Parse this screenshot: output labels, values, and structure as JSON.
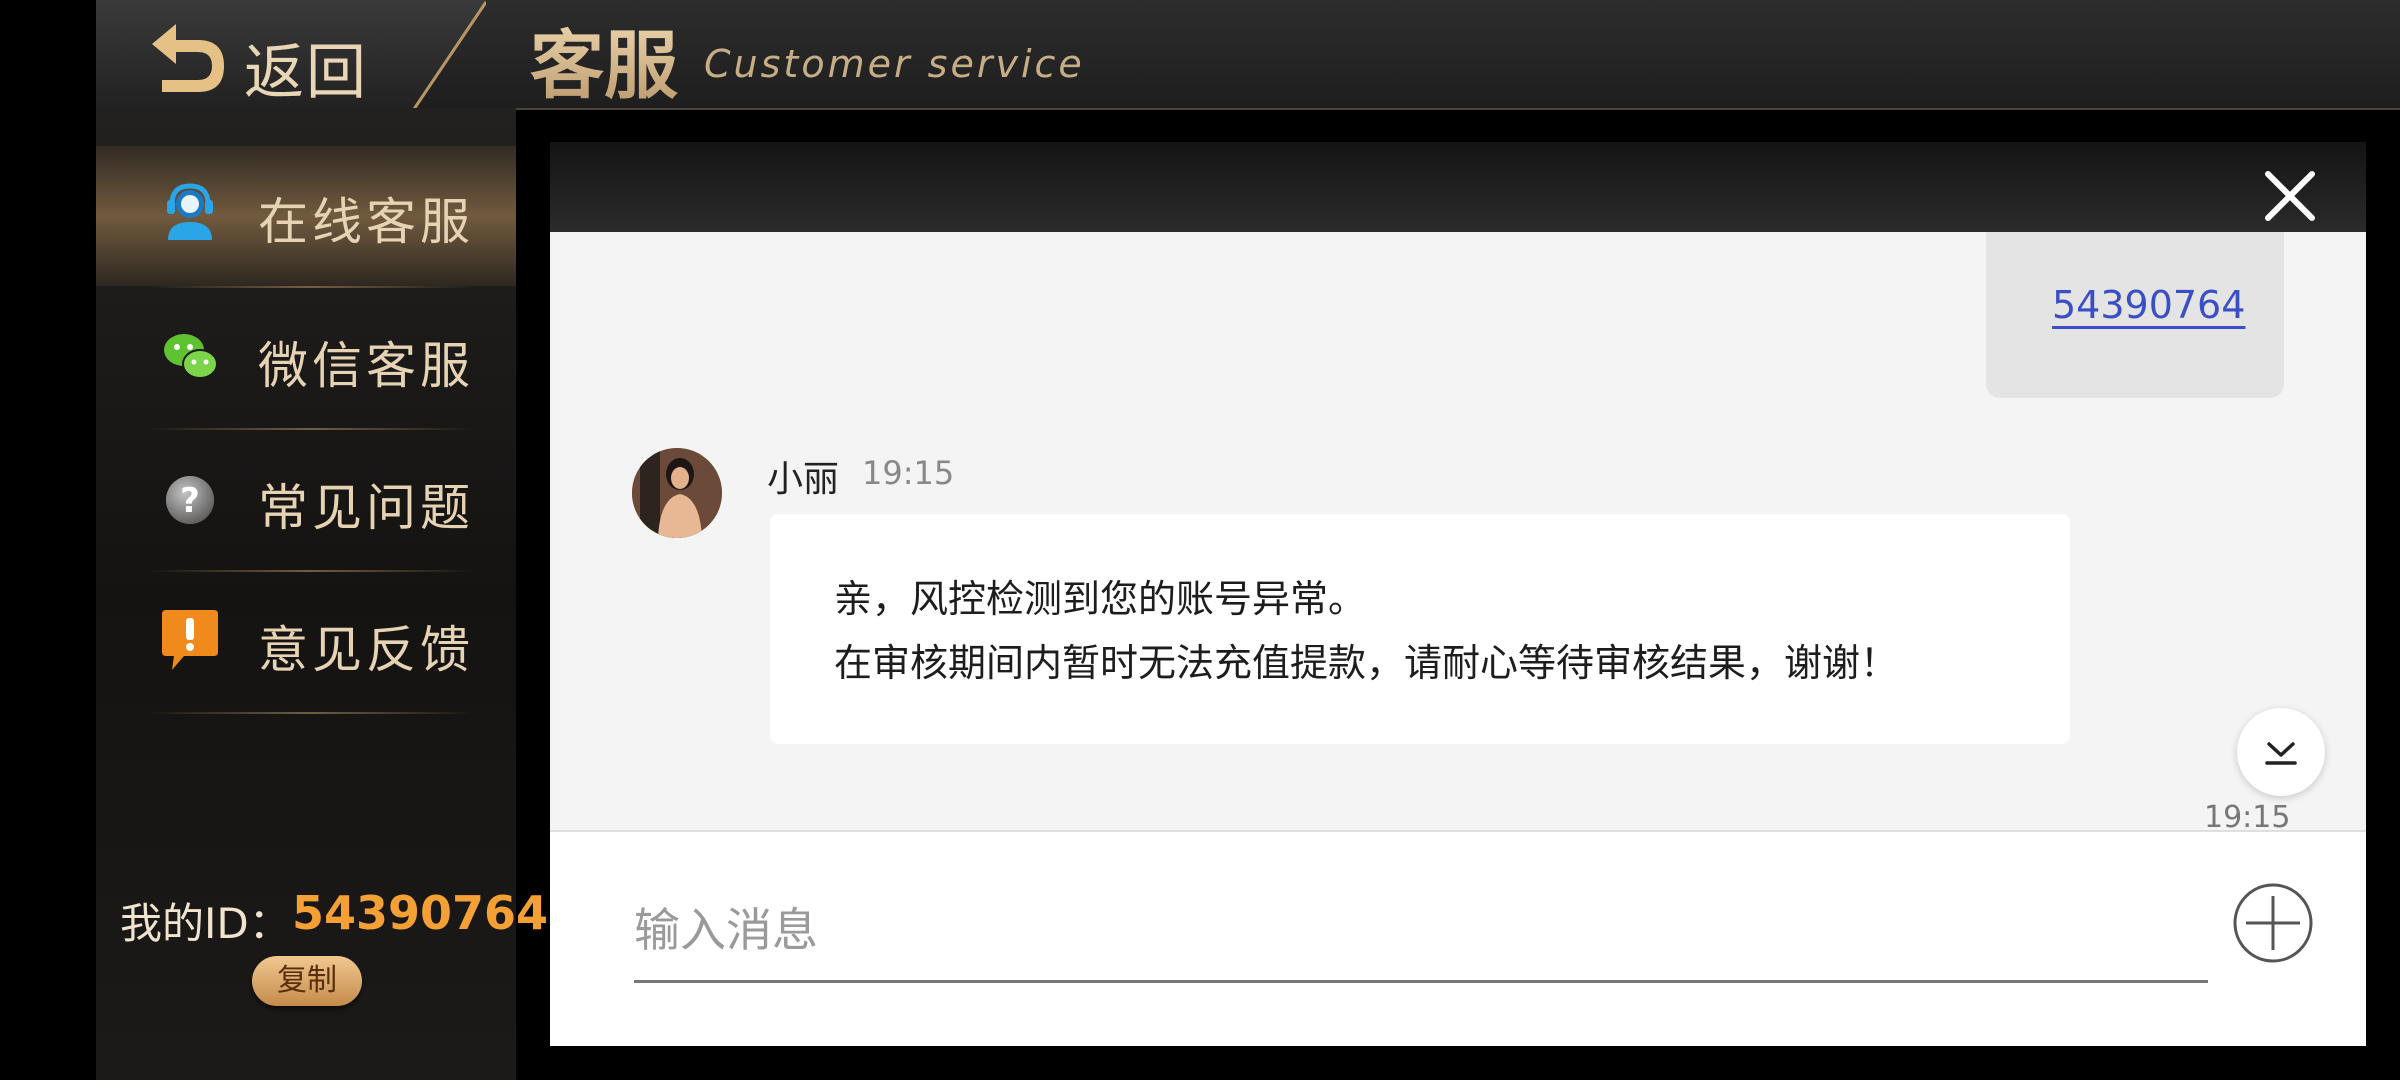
{
  "header": {
    "back_label": "返回",
    "title_cn": "客服",
    "title_en": "Customer service"
  },
  "sidebar": {
    "items": [
      {
        "label": "在线客服",
        "icon": "headset-icon",
        "active": true
      },
      {
        "label": "微信客服",
        "icon": "wechat-icon",
        "active": false
      },
      {
        "label": "常见问题",
        "icon": "question-icon",
        "active": false
      },
      {
        "label": "意见反馈",
        "icon": "feedback-icon",
        "active": false
      }
    ],
    "id_label": "我的ID：",
    "id_value": "54390764",
    "copy_label": "复制"
  },
  "chat": {
    "sent_message": "54390764",
    "sender_name": "小丽",
    "sender_time": "19:15",
    "message_lines": [
      "亲，风控检测到您的账号异常。",
      "在审核期间内暂时无法充值提款，请耐心等待审核结果，谢谢！"
    ],
    "bottom_time": "19:15",
    "input_placeholder": "输入消息"
  },
  "colors": {
    "accent_gold": "#d9c09a",
    "id_orange": "#f5a035",
    "link_blue": "#3a4fc6",
    "wechat_green": "#5fc231",
    "feedback_orange": "#f08a1c",
    "headset_blue": "#2aa6e8"
  }
}
